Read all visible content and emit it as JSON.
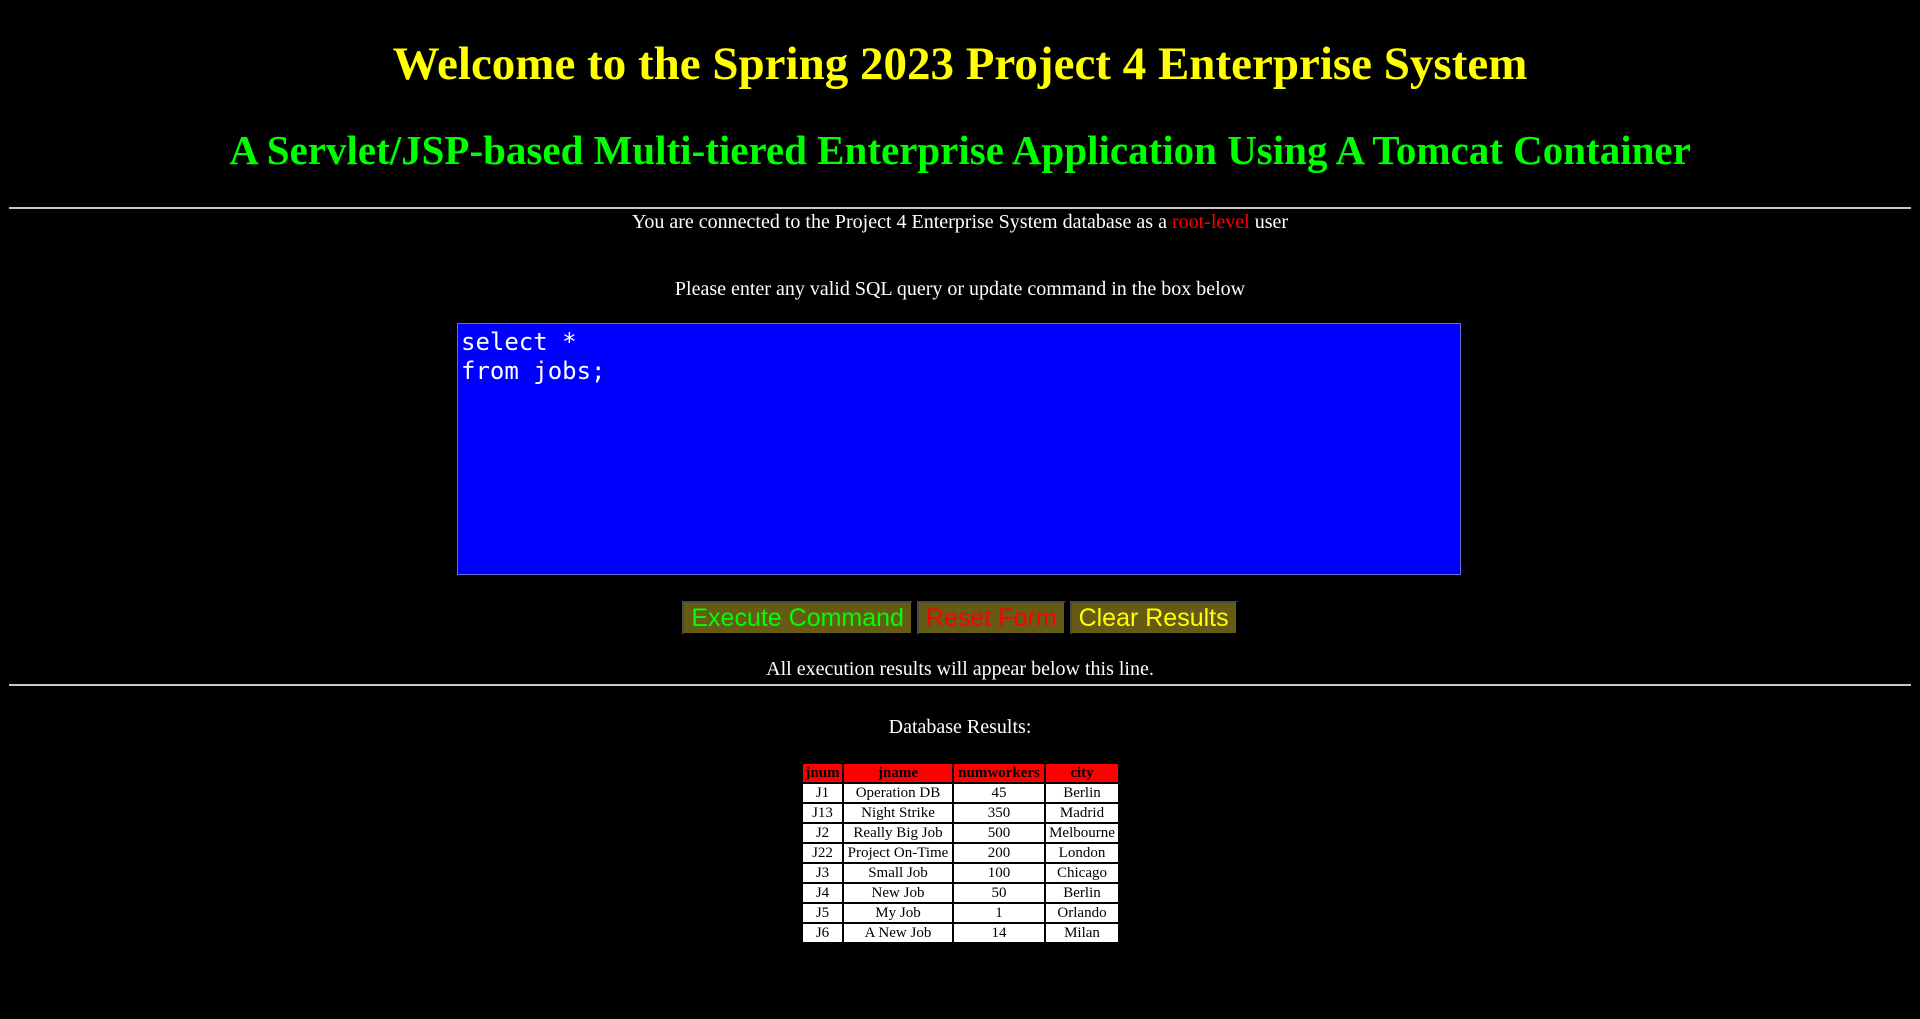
{
  "header": {
    "title": "Welcome to the Spring 2023 Project 4 Enterprise System",
    "subtitle": "A Servlet/JSP-based Multi-tiered Enterprise Application Using A Tomcat Container"
  },
  "connection": {
    "prefix": "You are connected to the Project 4 Enterprise System database as a ",
    "role": "root-level",
    "suffix": " user"
  },
  "prompt": "Please enter any valid SQL query or update command in the box below",
  "query": {
    "value": "select *\nfrom jobs;"
  },
  "buttons": {
    "execute": "Execute Command",
    "reset": "Reset Form",
    "clear": "Clear Results"
  },
  "results_note": "All execution results will appear below this line.",
  "results": {
    "label": "Database Results:",
    "columns": [
      "jnum",
      "jname",
      "numworkers",
      "city"
    ],
    "rows": [
      [
        "J1",
        "Operation DB",
        "45",
        "Berlin"
      ],
      [
        "J13",
        "Night Strike",
        "350",
        "Madrid"
      ],
      [
        "J2",
        "Really Big Job",
        "500",
        "Melbourne"
      ],
      [
        "J22",
        "Project On-Time",
        "200",
        "London"
      ],
      [
        "J3",
        "Small Job",
        "100",
        "Chicago"
      ],
      [
        "J4",
        "New Job",
        "50",
        "Berlin"
      ],
      [
        "J5",
        "My Job",
        "1",
        "Orlando"
      ],
      [
        "J6",
        "A New Job",
        "14",
        "Milan"
      ]
    ]
  },
  "colors": {
    "background": "#000000",
    "title": "#ffff00",
    "subtitle": "#00ff00",
    "role_highlight": "#ff0000",
    "query_box": "#0000ff",
    "button_bg": "#665b15",
    "table_header": "#ff0000"
  }
}
